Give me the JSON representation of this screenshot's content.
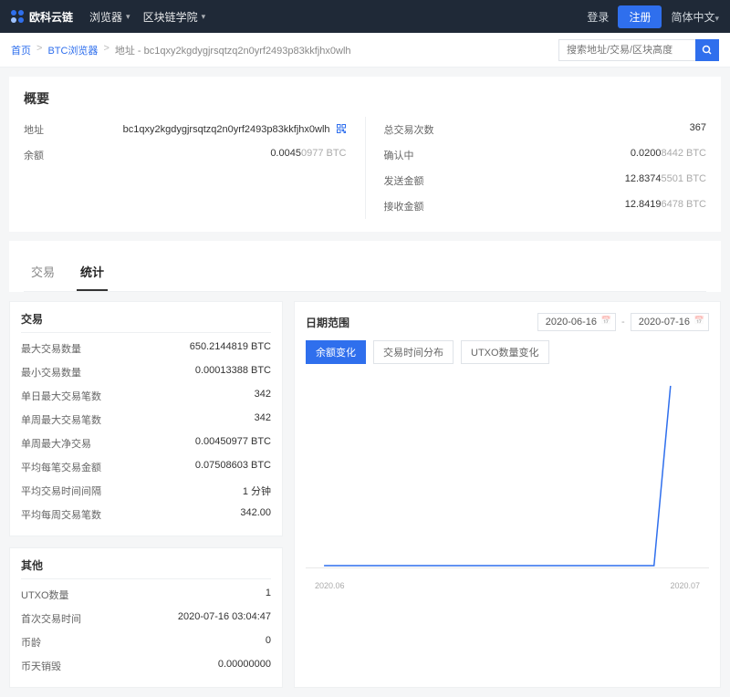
{
  "brand": "欧科云链",
  "nav": {
    "explorers": "浏览器",
    "academy": "区块链学院"
  },
  "auth": {
    "login": "登录",
    "signup": "注册",
    "language": "简体中文"
  },
  "breadcrumbs": {
    "home": "首页",
    "explorer": "BTC浏览器",
    "current": "地址 - bc1qxy2kgdygjrsqtzq2n0yrf2493p83kkfjhx0wlh"
  },
  "search_placeholder": "搜索地址/交易/区块高度",
  "overview": {
    "title": "概要",
    "address_label": "地址",
    "address": "bc1qxy2kgdygjrsqtzq2n0yrf2493p83kkfjhx0wlh",
    "balance_label": "余额",
    "balance_main": "0.0045",
    "balance_suffix": "0977 BTC",
    "txcount_label": "总交易次数",
    "txcount": "367",
    "confirming_label": "确认中",
    "confirming_main": "0.0200",
    "confirming_suffix": "8442 BTC",
    "sent_label": "发送金额",
    "sent_main": "12.8374",
    "sent_suffix": "5501 BTC",
    "recv_label": "接收金额",
    "recv_main": "12.8419",
    "recv_suffix": "6478 BTC"
  },
  "tabs": {
    "tx": "交易",
    "stats": "统计"
  },
  "stats_tx": {
    "title": "交易",
    "max_qty_label": "最大交易数量",
    "max_qty": "650.2144819 BTC",
    "min_qty_label": "最小交易数量",
    "min_qty": "0.00013388 BTC",
    "day_max_label": "单日最大交易笔数",
    "day_max": "342",
    "week_max_label": "单周最大交易笔数",
    "week_max": "342",
    "week_net_label": "单周最大净交易",
    "week_net": "0.00450977 BTC",
    "avg_amt_label": "平均每笔交易金额",
    "avg_amt": "0.07508603 BTC",
    "avg_interval_label": "平均交易时间间隔",
    "avg_interval": "1 分钟",
    "avg_perweek_label": "平均每周交易笔数",
    "avg_perweek": "342.00"
  },
  "stats_other": {
    "title": "其他",
    "utxo_label": "UTXO数量",
    "utxo": "1",
    "first_label": "首次交易时间",
    "first": "2020-07-16 03:04:47",
    "coinage_label": "币龄",
    "coinage": "0",
    "destroyed_label": "币天销毁",
    "destroyed": "0.00000000"
  },
  "chart": {
    "range_title": "日期范围",
    "from": "2020-06-16",
    "to": "2020-07-16",
    "dash": "-",
    "tab_balance": "余额变化",
    "tab_timedist": "交易时间分布",
    "tab_utxo": "UTXO数量变化",
    "x_left": "2020.06",
    "x_right": "2020.07"
  },
  "chart_data": {
    "type": "line",
    "title": "余额变化",
    "xlabel": "",
    "ylabel": "",
    "x": [
      "2020.06",
      "2020.07"
    ],
    "series": [
      {
        "name": "余额变化",
        "values": [
          0,
          0.0045
        ]
      }
    ],
    "ylim": [
      0,
      0.005
    ],
    "grid": false
  }
}
